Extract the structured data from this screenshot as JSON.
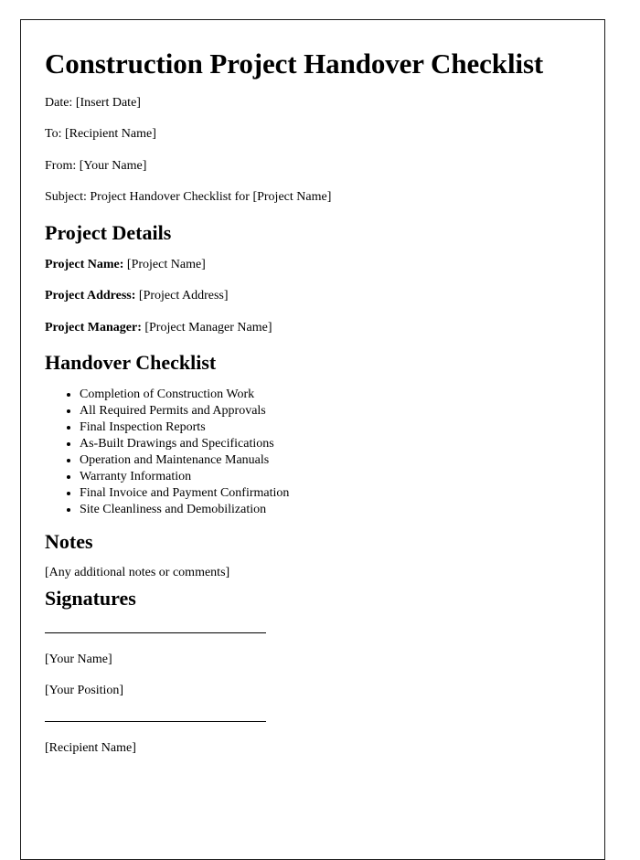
{
  "document": {
    "title": "Construction Project Handover Checklist",
    "header_lines": [
      "Date: [Insert Date]",
      "To: [Recipient Name]",
      "From: [Your Name]",
      "Subject: Project Handover Checklist for [Project Name]"
    ],
    "project_details": {
      "heading": "Project Details",
      "fields": [
        {
          "label": "Project Name:",
          "value": "[Project Name]"
        },
        {
          "label": "Project Address:",
          "value": "[Project Address]"
        },
        {
          "label": "Project Manager:",
          "value": "[Project Manager Name]"
        }
      ]
    },
    "handover_checklist": {
      "heading": "Handover Checklist",
      "items": [
        "Completion of Construction Work",
        "All Required Permits and Approvals",
        "Final Inspection Reports",
        "As-Built Drawings and Specifications",
        "Operation and Maintenance Manuals",
        "Warranty Information",
        "Final Invoice and Payment Confirmation",
        "Site Cleanliness and Demobilization"
      ]
    },
    "notes": {
      "heading": "Notes",
      "body": "[Any additional notes or comments]"
    },
    "signatures": {
      "heading": "Signatures",
      "sender": {
        "name": "[Your Name]",
        "position": "[Your Position]"
      },
      "recipient": {
        "name": "[Recipient Name]"
      }
    }
  }
}
